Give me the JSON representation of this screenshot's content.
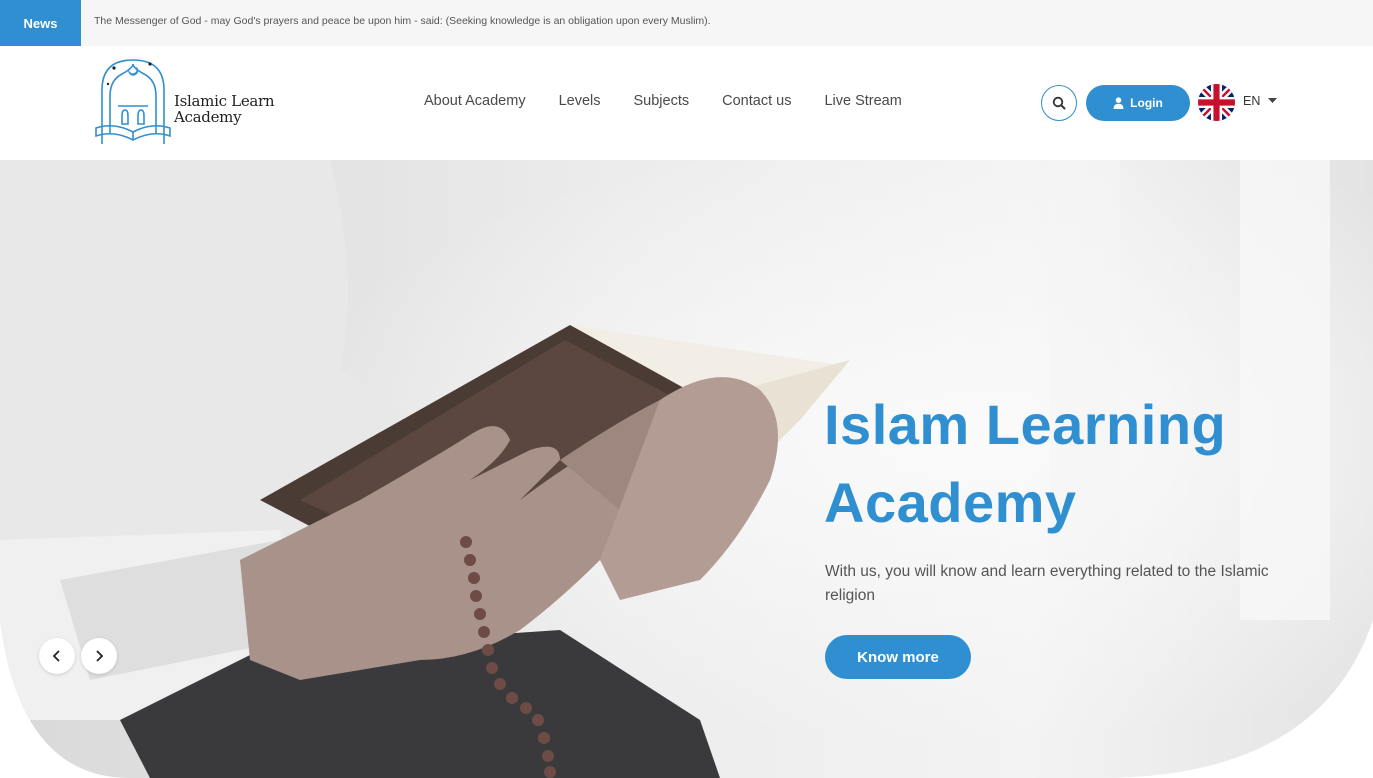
{
  "news": {
    "tag": "News",
    "text": "The Messenger of God - may God's prayers and peace be upon him - said: (Seeking knowledge is an obligation upon every Muslim)."
  },
  "logo": {
    "line1": "Islamic Learn",
    "line2": "Academy"
  },
  "nav": {
    "items": [
      {
        "label": "About Academy"
      },
      {
        "label": "Levels"
      },
      {
        "label": "Subjects"
      },
      {
        "label": "Contact us"
      },
      {
        "label": "Live Stream"
      }
    ]
  },
  "header": {
    "login_label": "Login",
    "language": "EN",
    "search_icon": "search-icon",
    "user_icon": "user-icon",
    "flag_icon": "uk-flag-icon"
  },
  "hero": {
    "title_line1": "Islam Learning",
    "title_line2": "Academy",
    "subtitle": "With us, you will know and learn everything related to the Islamic religion",
    "button_label": "Know more"
  },
  "colors": {
    "accent": "#2f8fd0",
    "text": "#444444",
    "newsbar_bg": "#f6f6f6"
  }
}
